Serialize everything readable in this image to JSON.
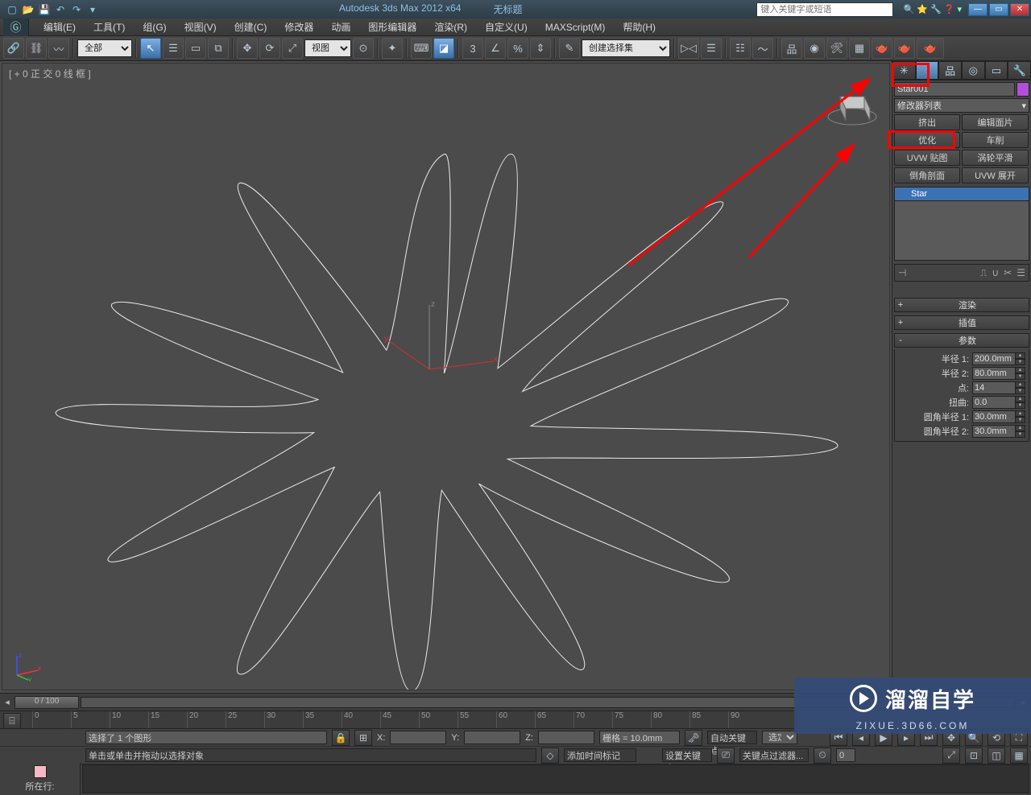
{
  "title": {
    "app": "Autodesk 3ds Max  2012 x64",
    "doc": "无标题",
    "search_placeholder": "键入关键字或短语"
  },
  "menus": [
    "编辑(E)",
    "工具(T)",
    "组(G)",
    "视图(V)",
    "创建(C)",
    "修改器",
    "动画",
    "图形编辑器",
    "渲染(R)",
    "自定义(U)",
    "MAXScript(M)",
    "帮助(H)"
  ],
  "filter_dropdown": "全部",
  "view_dropdown": "视图",
  "selset_dropdown": "创建选择集",
  "viewport_label": "[ + 0  正 交 0 线 框  ]",
  "cmdpanel": {
    "object_name": "Star001",
    "modlist_label": "修改器列表",
    "mod_buttons": [
      "挤出",
      "编辑面片",
      "优化",
      "车削",
      "UVW 贴图",
      "涡轮平滑",
      "倒角剖面",
      "UVW 展开"
    ],
    "stack_item": "Star",
    "rollouts": {
      "render": "渲染",
      "interp": "插值",
      "params": "参数"
    },
    "params": {
      "radius1": {
        "label": "半径 1:",
        "value": "200.0mm"
      },
      "radius2": {
        "label": "半径 2:",
        "value": "80.0mm"
      },
      "points": {
        "label": "点:",
        "value": "14"
      },
      "distort": {
        "label": "扭曲:",
        "value": "0.0"
      },
      "fillet1": {
        "label": "圆角半径 1:",
        "value": "30.0mm"
      },
      "fillet2": {
        "label": "圆角半径 2:",
        "value": "30.0mm"
      }
    }
  },
  "timeslider": {
    "pos": "0 / 100"
  },
  "trackbar_ticks": [
    "0",
    "5",
    "10",
    "15",
    "20",
    "25",
    "30",
    "35",
    "40",
    "45",
    "50",
    "55",
    "60",
    "65",
    "70",
    "75",
    "80",
    "85",
    "90"
  ],
  "status": {
    "selected": "选择了 1 个图形",
    "grid": "栅格 = 10.0mm",
    "prompt": "单击或单击并拖动以选择对象",
    "nowat": "所在行:",
    "addtag": "添加时间标记",
    "autokey": "自动关键点",
    "seldrop": "选定对",
    "setkey": "设置关键点",
    "keyfilter": "关键点过滤器...",
    "x": "X:",
    "y": "Y:",
    "z": "Z:",
    "frame": "0"
  },
  "watermark": {
    "brand": "溜溜自学",
    "url": "ZIXUE.3D66.COM"
  }
}
